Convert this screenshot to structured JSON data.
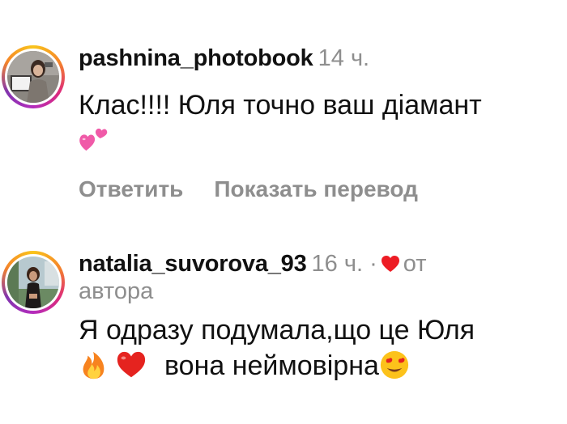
{
  "comments": [
    {
      "username": "pashnina_photobook",
      "time": "14 ч.",
      "text": "Клас!!!! Юля точно ваш діамант",
      "emoji": "two-hearts",
      "reply_label": "Ответить",
      "translate_label": "Показать перевод"
    },
    {
      "username": "natalia_suvorova_93",
      "time": "16 ч.",
      "separator": "·",
      "liked_prefix": "от",
      "liked_suffix": "автора",
      "text_line1": "Я одразу подумала,що це Юля",
      "text_line2": "вона неймовірна",
      "emojis": [
        "fire",
        "red-heart",
        "heart-eyes"
      ]
    }
  ],
  "colors": {
    "secondary_text": "#8e8e8e",
    "heart": "#ed1c24"
  }
}
